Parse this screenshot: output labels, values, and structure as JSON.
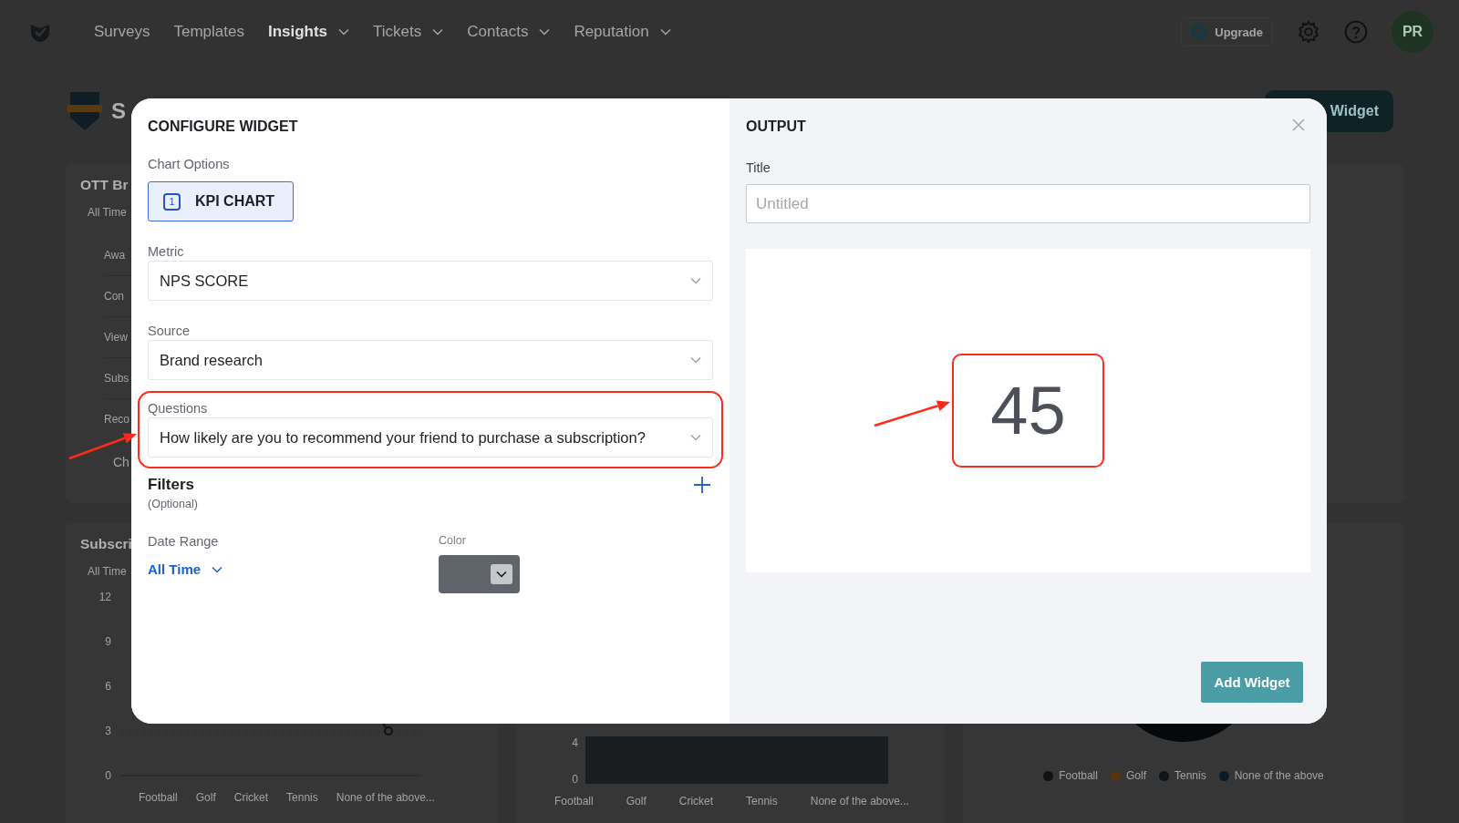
{
  "nav": {
    "items": [
      {
        "label": "Surveys",
        "selected": false,
        "dropdown": false
      },
      {
        "label": "Templates",
        "selected": false,
        "dropdown": false
      },
      {
        "label": "Insights",
        "selected": true,
        "dropdown": true
      },
      {
        "label": "Tickets",
        "selected": false,
        "dropdown": true
      },
      {
        "label": "Contacts",
        "selected": false,
        "dropdown": true
      },
      {
        "label": "Reputation",
        "selected": false,
        "dropdown": true
      }
    ],
    "upgrade_button": "Upgrade",
    "avatar": "PR"
  },
  "page": {
    "title": "S",
    "primary_button": "Widget",
    "list_card": {
      "title": "OTT Br",
      "date_range": "All Time",
      "rows": [
        "Awa",
        "Con",
        "View",
        "Subs",
        "Reco"
      ],
      "footer": "Ch"
    },
    "line_card": {
      "title": "Subscri",
      "date_range": "All Time",
      "y_axis_labels": [
        "12",
        "9",
        "6",
        "3",
        "0"
      ],
      "x_axis_labels": [
        "Football",
        "Golf",
        "Cricket",
        "Tennis",
        "None of the above..."
      ]
    },
    "area_card": {
      "y_axis_labels": [
        "4",
        "0"
      ],
      "x_axis_labels": [
        "Football",
        "Golf",
        "Cricket",
        "Tennis",
        "None of the above..."
      ]
    },
    "donut_card": {
      "legend": [
        {
          "label": "Football",
          "color": "#0d1216"
        },
        {
          "label": "Golf",
          "color": "#5a3310"
        },
        {
          "label": "Tennis",
          "color": "#0e1418"
        },
        {
          "label": "None of the above",
          "color": "#0d1a24"
        }
      ]
    }
  },
  "modal": {
    "title": "CONFIGURE WIDGET",
    "chart_options_label": "Chart Options",
    "chart_options": [
      {
        "number": "1",
        "label": "KPI CHART",
        "selected": true
      }
    ],
    "fields": [
      {
        "label": "Metric",
        "value": "NPS SCORE",
        "highlighted": false
      },
      {
        "label": "Source",
        "value": "Brand research",
        "highlighted": false
      },
      {
        "label": "Questions",
        "value": "How likely are you to recommend your friend to purchase a subscription?",
        "highlighted": true
      }
    ],
    "filters": {
      "title": "Filters",
      "note": "(Optional)"
    },
    "date_range": {
      "label": "Date Range",
      "value": "All Time"
    },
    "color_picker": {
      "label": "Color",
      "color": "#60646b"
    },
    "output": {
      "title": "OUTPUT",
      "title_field_label": "Title",
      "title_placeholder": "Untitled",
      "kpi_value": "45",
      "kpi_highlighted": true,
      "add_button": "Add Widget"
    }
  }
}
